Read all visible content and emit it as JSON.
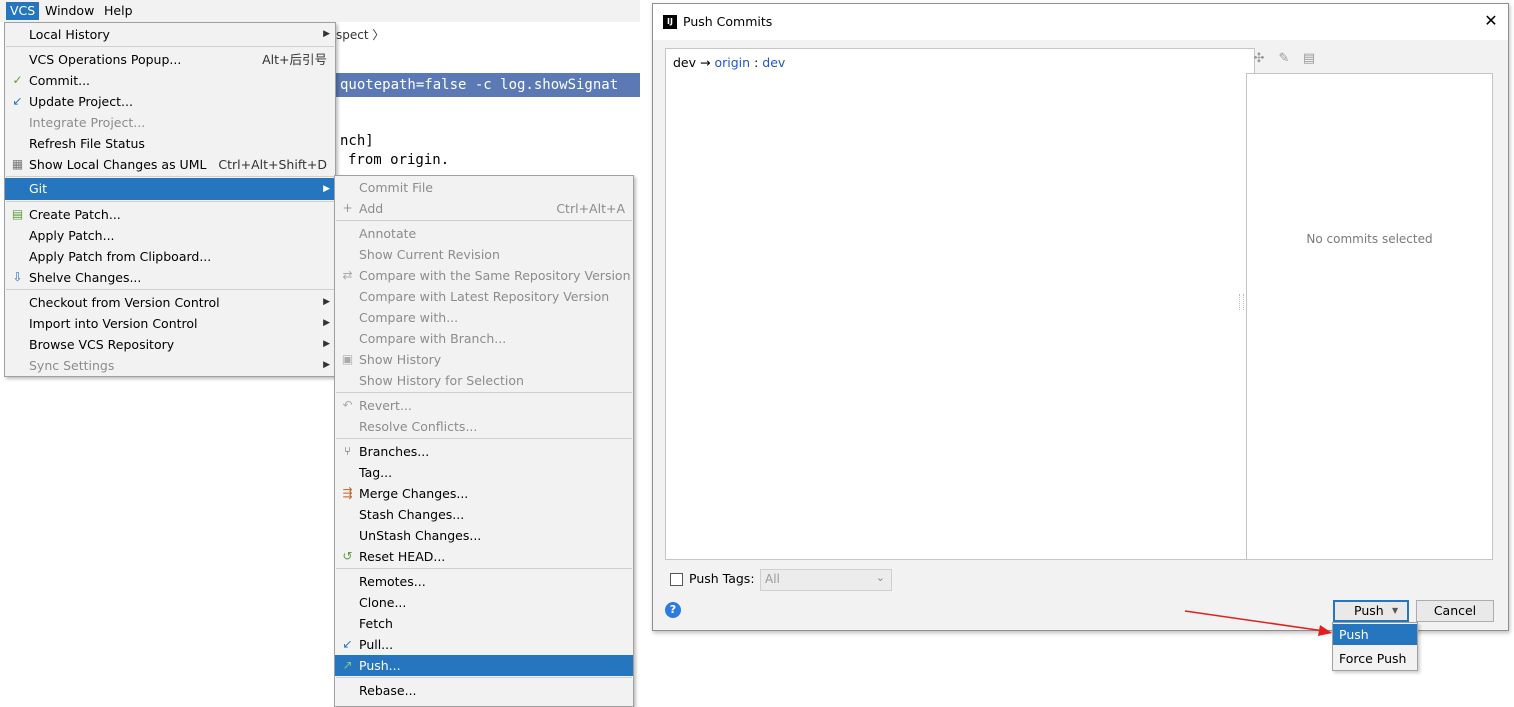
{
  "menubar": {
    "vcs": "VCS",
    "window": "Window",
    "help": "Help"
  },
  "background": {
    "crumb": "spect",
    "selected_line": "quotepath=false -c log.showSignat",
    "line1": "nch]",
    "line2": "from origin."
  },
  "vcs_menu": [
    {
      "label": "Local History",
      "arrow": "▶"
    },
    {
      "label": "VCS Operations Popup...",
      "shortcut": "Alt+后引号"
    },
    {
      "label": "Commit..."
    },
    {
      "label": "Update Project..."
    },
    {
      "label": "Integrate Project...",
      "disabled": true
    },
    {
      "label": "Refresh File Status"
    },
    {
      "label": "Show Local Changes as UML",
      "shortcut": "Ctrl+Alt+Shift+D"
    },
    {
      "label": "Git",
      "arrow": "▶",
      "selected": true
    },
    {
      "label": "Create Patch..."
    },
    {
      "label": "Apply Patch..."
    },
    {
      "label": "Apply Patch from Clipboard..."
    },
    {
      "label": "Shelve Changes..."
    },
    {
      "label": "Checkout from Version Control",
      "arrow": "▶"
    },
    {
      "label": "Import into Version Control",
      "arrow": "▶"
    },
    {
      "label": "Browse VCS Repository",
      "arrow": "▶"
    },
    {
      "label": "Sync Settings",
      "arrow": "▶",
      "disabled": true
    }
  ],
  "git_menu": [
    {
      "label": "Commit File",
      "disabled": true
    },
    {
      "label": "Add",
      "shortcut": "Ctrl+Alt+A",
      "disabled": true
    },
    {
      "label": "Annotate",
      "disabled": true
    },
    {
      "label": "Show Current Revision",
      "disabled": true
    },
    {
      "label": "Compare with the Same Repository Version",
      "disabled": true
    },
    {
      "label": "Compare with Latest Repository Version",
      "disabled": true
    },
    {
      "label": "Compare with...",
      "disabled": true
    },
    {
      "label": "Compare with Branch...",
      "disabled": true
    },
    {
      "label": "Show History",
      "disabled": true
    },
    {
      "label": "Show History for Selection",
      "disabled": true
    },
    {
      "label": "Revert...",
      "disabled": true
    },
    {
      "label": "Resolve Conflicts...",
      "disabled": true
    },
    {
      "label": "Branches..."
    },
    {
      "label": "Tag..."
    },
    {
      "label": "Merge Changes..."
    },
    {
      "label": "Stash Changes..."
    },
    {
      "label": "UnStash Changes..."
    },
    {
      "label": "Reset HEAD..."
    },
    {
      "label": "Remotes..."
    },
    {
      "label": "Clone..."
    },
    {
      "label": "Fetch"
    },
    {
      "label": "Pull..."
    },
    {
      "label": "Push...",
      "selected": true
    },
    {
      "label": "Rebase..."
    }
  ],
  "dialog": {
    "title": "Push Commits",
    "close": "✕",
    "branch_local": "dev",
    "branch_arrow": "→",
    "branch_remote": "origin",
    "branch_sep": ":",
    "branch_target": "dev",
    "no_commits": "No commits selected",
    "push_tags_label": "Push Tags:",
    "push_tags_value": "All",
    "help": "?",
    "push_button": "Push",
    "cancel_button": "Cancel"
  },
  "push_popup": {
    "push": "Push",
    "force_push": "Force Push"
  },
  "colors": {
    "selection": "#2675bf",
    "link": "#2156c9",
    "arrow_annotation": "#e02020"
  }
}
